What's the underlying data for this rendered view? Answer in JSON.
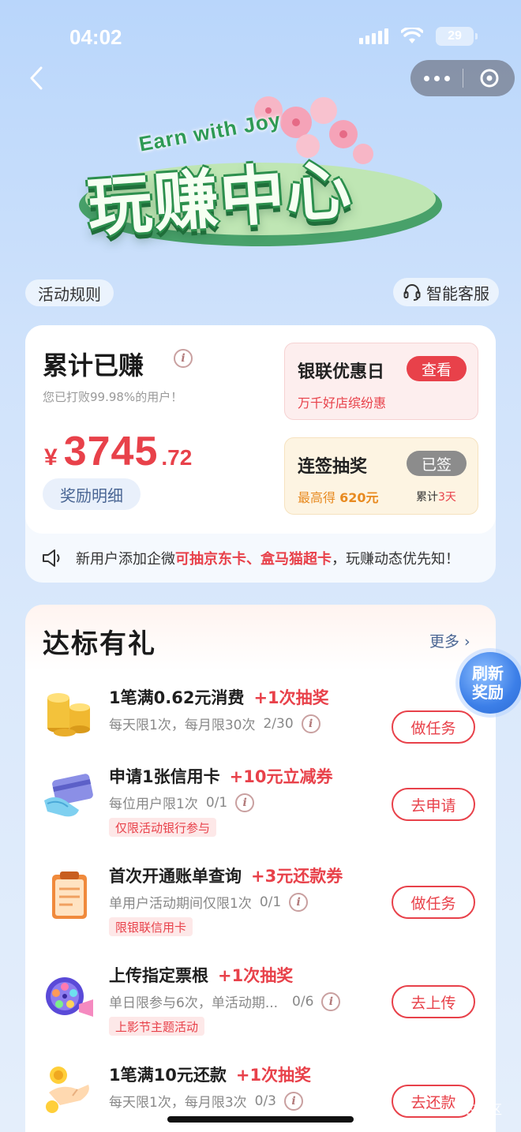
{
  "status_bar": {
    "time": "04:02",
    "battery": "29"
  },
  "hero": {
    "subtitle": "Earn with Joy",
    "title": "玩赚中心"
  },
  "top_links": {
    "rules": "活动规则",
    "service": "智能客服"
  },
  "earnings": {
    "title": "累计已赚",
    "beat_text": "您已打败99.98%的用户！",
    "currency": "¥",
    "amount_int": "3745",
    "amount_dec": ".72",
    "detail_label": "奖励明细",
    "unionpay": {
      "title": "银联优惠日",
      "button": "查看",
      "sub": "万千好店缤纷惠"
    },
    "lottery": {
      "title": "连签抽奖",
      "button": "已签",
      "max_prefix": "最高得 ",
      "max_value": "620元",
      "days_prefix": "累计",
      "days_value": "3天"
    }
  },
  "notice": {
    "prefix": "新用户添加企微",
    "highlight": "可抽京东卡、盒马猫超卡",
    "suffix": "，玩赚动态优先知！"
  },
  "tasks": {
    "title": "达标有礼",
    "more": "更多 ›",
    "refresh": "刷新奖励",
    "items": [
      {
        "name": "1笔满0.62元消费",
        "reward": "+1次抽奖",
        "limit": "每天限1次，每月限30次",
        "progress": "2/30",
        "tag": "",
        "button": "做任务"
      },
      {
        "name": "申请1张信用卡",
        "reward": "+10元立减券",
        "limit": "每位用户限1次",
        "progress": "0/1",
        "tag": "仅限活动银行参与",
        "button": "去申请"
      },
      {
        "name": "首次开通账单查询",
        "reward": "+3元还款券",
        "limit": "单用户活动期间仅限1次",
        "progress": "0/1",
        "tag": "限银联信用卡",
        "button": "做任务"
      },
      {
        "name": "上传指定票根",
        "reward": "+1次抽奖",
        "limit": "单日限参与6次，单活动期...",
        "progress": "0/6",
        "tag": "上影节主题活动",
        "button": "去上传"
      },
      {
        "name": "1笔满10元还款",
        "reward": "+1次抽奖",
        "limit": "每天限1次，每月限3次",
        "progress": "0/3",
        "tag": "",
        "button": "去还款"
      }
    ]
  },
  "watermark": "卡农社区",
  "colors": {
    "accent": "#e8414a",
    "link": "#4a6694",
    "hero_green": "#2c8f4d"
  }
}
